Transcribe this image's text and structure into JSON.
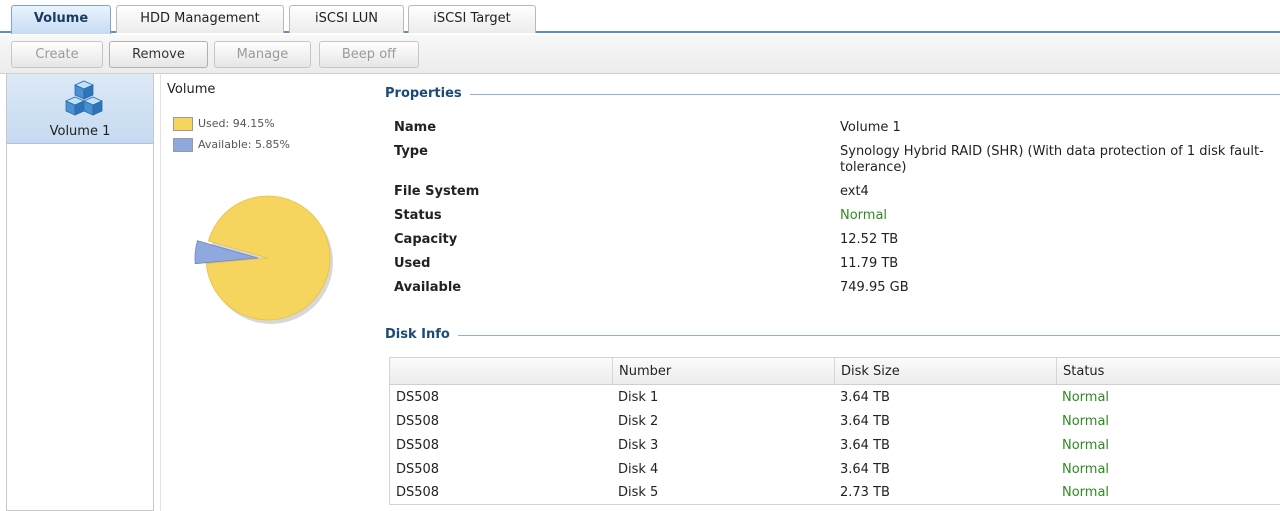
{
  "tabs": [
    {
      "label": "Volume",
      "active": true
    },
    {
      "label": "HDD Management",
      "active": false
    },
    {
      "label": "iSCSI LUN",
      "active": false
    },
    {
      "label": "iSCSI Target",
      "active": false
    }
  ],
  "toolbar": {
    "create_label": "Create",
    "remove_label": "Remove",
    "manage_label": "Manage",
    "beep_off_label": "Beep off"
  },
  "volume_list": {
    "items": [
      {
        "label": "Volume 1",
        "icon": "volume-cubes-icon",
        "selected": true
      }
    ]
  },
  "chart": {
    "title": "Volume",
    "legend": [
      {
        "label": "Used: 94.15%",
        "color": "#f5d55d"
      },
      {
        "label": "Available: 5.85%",
        "color": "#8fa8de"
      }
    ]
  },
  "chart_data": {
    "type": "pie",
    "title": "Volume",
    "categories": [
      "Used",
      "Available"
    ],
    "values": [
      94.15,
      5.85
    ],
    "colors": [
      "#f5d55d",
      "#8fa8de"
    ],
    "legend_position": "top-left"
  },
  "properties": {
    "heading": "Properties",
    "rows": [
      {
        "key": "Name",
        "value": "Volume 1"
      },
      {
        "key": "Type",
        "value": "Synology Hybrid RAID (SHR) (With data protection of 1 disk fault-tolerance)"
      },
      {
        "key": "File System",
        "value": "ext4"
      },
      {
        "key": "Status",
        "value": "Normal"
      },
      {
        "key": "Capacity",
        "value": "12.52 TB"
      },
      {
        "key": "Used",
        "value": "11.79 TB"
      },
      {
        "key": "Available",
        "value": "749.95 GB"
      }
    ]
  },
  "disk_info": {
    "heading": "Disk Info",
    "columns": [
      "",
      "Number",
      "Disk Size",
      "Status"
    ],
    "rows": [
      {
        "model": "DS508",
        "number": "Disk 1",
        "size": "3.64 TB",
        "status": "Normal"
      },
      {
        "model": "DS508",
        "number": "Disk 2",
        "size": "3.64 TB",
        "status": "Normal"
      },
      {
        "model": "DS508",
        "number": "Disk 3",
        "size": "3.64 TB",
        "status": "Normal"
      },
      {
        "model": "DS508",
        "number": "Disk 4",
        "size": "3.64 TB",
        "status": "Normal"
      },
      {
        "model": "DS508",
        "number": "Disk 5",
        "size": "2.73 TB",
        "status": "Normal"
      }
    ]
  },
  "colors": {
    "accent": "#5d91c6",
    "status_ok": "#2e8b1e",
    "section_heading": "#1b4a78"
  }
}
